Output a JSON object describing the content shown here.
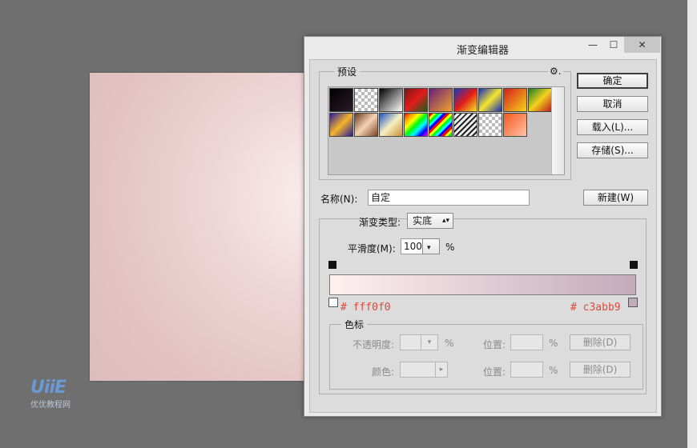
{
  "dialog": {
    "title": "渐变编辑器",
    "controls": {
      "minimize": "—",
      "maximize": "☐",
      "close": "✕"
    }
  },
  "presets": {
    "legend": "预设",
    "gear": "⚙.",
    "swatch_rows": [
      [
        "linear-gradient(135deg,#000,#2b1b2a)",
        "repeating-conic-gradient(#bbb 0 25%, #fff 0 50%) 0 0/8px 8px",
        "linear-gradient(135deg,#000,#fff)",
        "linear-gradient(135deg,#7a1515,#e31b1b,#1a5d1a)",
        "linear-gradient(135deg,#6b1f7b,#f0a32a)",
        "linear-gradient(135deg,#1a36c0,#e21b1b,#f2e41d)",
        "linear-gradient(135deg,#1a2bb8,#f5e630,#1a2bb8)",
        "linear-gradient(135deg,#d81d1d,#f4d21a)",
        "linear-gradient(135deg,#1b7d2d,#f2d21d,#c31b1b)"
      ],
      [
        "linear-gradient(135deg,#2a1b9a,#f5b42a,#2a1b9a)",
        "linear-gradient(135deg,#6b3a1f,#f5d3b5,#7a4424)",
        "linear-gradient(135deg,#1a55c5,#f8f0c2,#c99035)",
        "linear-gradient(135deg,#ff0000,#ff9900,#ffff00,#00ff00,#00ffff,#0000ff,#ff00ff)",
        "repeating-linear-gradient(135deg,#f00 0 3px,#ff0 3px 6px,#0f0 6px 9px,#0ff 9px 12px,#00f 12px 15px)",
        "repeating-linear-gradient(135deg,#222 0 2px,#eee 2px 5px)",
        "repeating-conic-gradient(#bbb 0 25%, #fff 0 50%) 0 0/8px 8px",
        "linear-gradient(135deg,#f25a1d,#ffc2a8)"
      ]
    ]
  },
  "buttons": {
    "ok": "确定",
    "cancel": "取消",
    "load": "载入(L)...",
    "save": "存储(S)...",
    "new": "新建(W)"
  },
  "name": {
    "label": "名称(N):",
    "value": "自定"
  },
  "gradient": {
    "type_label": "渐变类型:",
    "type_value": "实底",
    "smooth_label": "平滑度(M):",
    "smooth_value": "100",
    "percent": "%",
    "start_color": "#fff0f0",
    "end_color": "#c3abb9",
    "start_hex_label": "# fff0f0",
    "end_hex_label": "# c3abb9"
  },
  "color_stops": {
    "legend": "色标",
    "opacity_label": "不透明度:",
    "color_label": "颜色:",
    "position_label": "位置:",
    "percent": "%",
    "delete_label": "删除(D)"
  },
  "watermark": {
    "logo": "UiiE",
    "text": "优优教程网"
  }
}
